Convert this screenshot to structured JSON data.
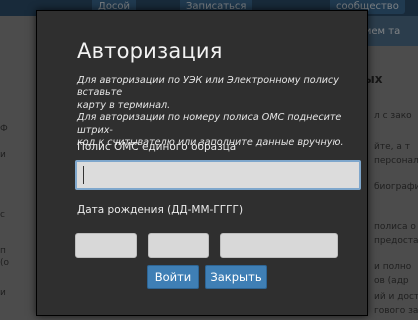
{
  "background": {
    "top_tabs": [
      "Досой",
      "Записаться",
      "сообщество"
    ],
    "right_strip_text": "прием та",
    "heading_fragment": "ьных",
    "right_lines": [
      "л с зако",
      "йте, а т",
      "персонал",
      "биографи",
      "полиса о",
      "предостав",
      "и полно",
      "ов (адр",
      "ий и дост",
      "гового за"
    ],
    "left_lines": [
      "Ф",
      "и",
      "с",
      "п",
      "(о",
      "и"
    ]
  },
  "modal": {
    "title": "Авторизация",
    "instructions": [
      "Для авторизации по УЭК или Электронному полису вставьте",
      "карту в терминал.",
      "Для авторизации по номеру полиса ОМС поднесите штрих-",
      "код к считывателю или заполните данные вручную."
    ],
    "policy_label": "Полис ОМС единого образца",
    "policy_value": "",
    "dob_label": "Дата рождения (ДД-ММ-ГГГГ)",
    "dob_day": "",
    "dob_month": "",
    "dob_year": "",
    "login_button": "Войти",
    "close_button": "Закрыть"
  }
}
